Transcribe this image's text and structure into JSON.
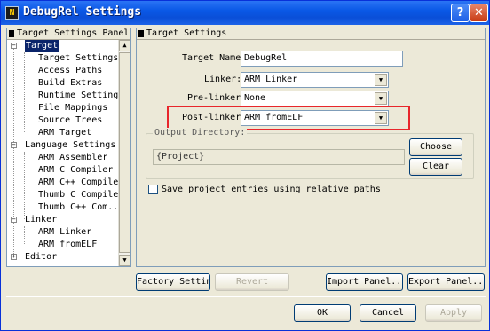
{
  "window": {
    "title": "DebugRel Settings",
    "help_glyph": "?",
    "close_glyph": "✕",
    "icon_glyph": "N"
  },
  "tree": {
    "header": "Target Settings Panels",
    "items": [
      {
        "label": "Target",
        "expander": "−"
      },
      {
        "label": "Target Settings"
      },
      {
        "label": "Access Paths"
      },
      {
        "label": "Build Extras"
      },
      {
        "label": "Runtime Settings"
      },
      {
        "label": "File Mappings"
      },
      {
        "label": "Source Trees"
      },
      {
        "label": "ARM Target"
      },
      {
        "label": "Language Settings",
        "expander": "−"
      },
      {
        "label": "ARM Assembler"
      },
      {
        "label": "ARM C Compiler"
      },
      {
        "label": "ARM C++ Compiler"
      },
      {
        "label": "Thumb C Compiler"
      },
      {
        "label": "Thumb C++ Com..."
      },
      {
        "label": "Linker",
        "expander": "−"
      },
      {
        "label": "ARM Linker"
      },
      {
        "label": "ARM fromELF"
      },
      {
        "label": "Editor",
        "expander": "+"
      }
    ],
    "scroll_up": "▲",
    "scroll_down": "▼"
  },
  "main": {
    "header": "Target Settings",
    "target_name_label": "Target Name:",
    "target_name_value": "DebugRel",
    "linker_label": "Linker:",
    "linker_value": "ARM Linker",
    "prelinker_label": "Pre-linker:",
    "prelinker_value": "None",
    "postlinker_label": "Post-linker:",
    "postlinker_value": "ARM fromELF",
    "output_dir_label": "Output Directory:",
    "output_dir_value": "{Project}",
    "choose_label": "Choose",
    "clear_label": "Clear",
    "save_relative_label": "Save project entries using relative paths",
    "save_relative_checked": false,
    "dropdown_glyph": "▼"
  },
  "footer": {
    "factory_settings": "Factory Settings",
    "revert": "Revert",
    "import_panel": "Import Panel...",
    "export_panel": "Export Panel...",
    "ok": "OK",
    "cancel": "Cancel",
    "apply": "Apply"
  },
  "colors": {
    "titlebar": "#0a58e6",
    "selection": "#0a246a",
    "highlight_box": "#e8262b"
  }
}
